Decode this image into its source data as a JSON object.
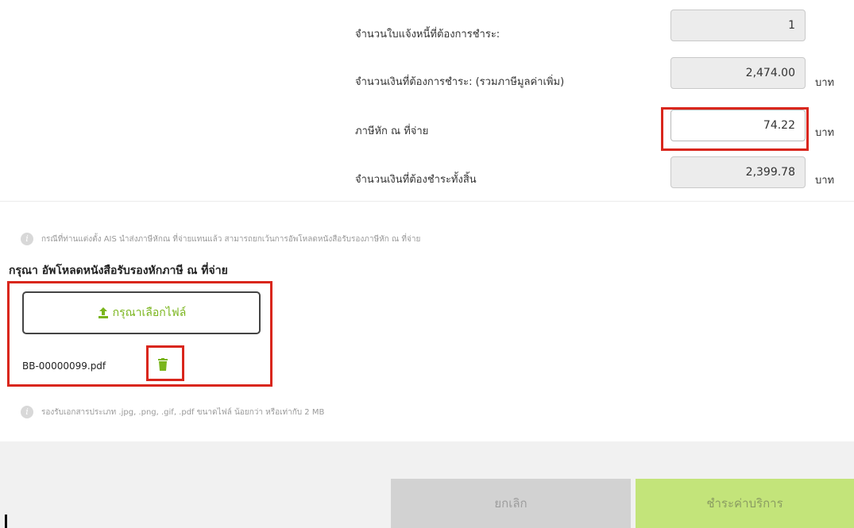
{
  "summary": {
    "invoice_count_label": "จำนวนใบแจ้งหนี้ที่ต้องการชำระ:",
    "invoice_count_value": "1",
    "amount_label": "จำนวนเงินที่ต้องการชำระ: (รวมภาษีมูลค่าเพิ่ม)",
    "amount_value": "2,474.00",
    "withholding_label": "ภาษีหัก ณ ที่จ่าย",
    "withholding_value": "74.22",
    "total_label": "จำนวนเงินที่ต้องชำระทั้งสิ้น",
    "total_value": "2,399.78",
    "unit": "บาท"
  },
  "notes": {
    "ais_note": "กรณีที่ท่านแต่งตั้ง AIS นำส่งภาษีหักณ ที่จ่ายแทนแล้ว สามารถยกเว้นการอัพโหลดหนังสือรับรองภาษีหัก ณ ที่จ่าย",
    "file_types_note": "รองรับเอกสารประเภท .jpg, .png, .gif, .pdf ขนาดไฟล์ น้อยกว่า หรือเท่ากับ 2 MB"
  },
  "upload": {
    "heading": "กรุณา อัพโหลดหนังสือรับรองหักภาษี ณ ที่จ่าย",
    "button_label": "กรุณาเลือกไฟล์",
    "file_name": "BB-00000099.pdf"
  },
  "footer": {
    "cancel_label": "ยกเลิก",
    "pay_label": "ชำระค่าบริการ"
  },
  "colors": {
    "accent_green": "#7ab51d",
    "pay_button_bg": "#c3e47a",
    "highlight_red": "#d9261c"
  },
  "icons": [
    "info-icon",
    "upload-icon",
    "trash-icon"
  ]
}
